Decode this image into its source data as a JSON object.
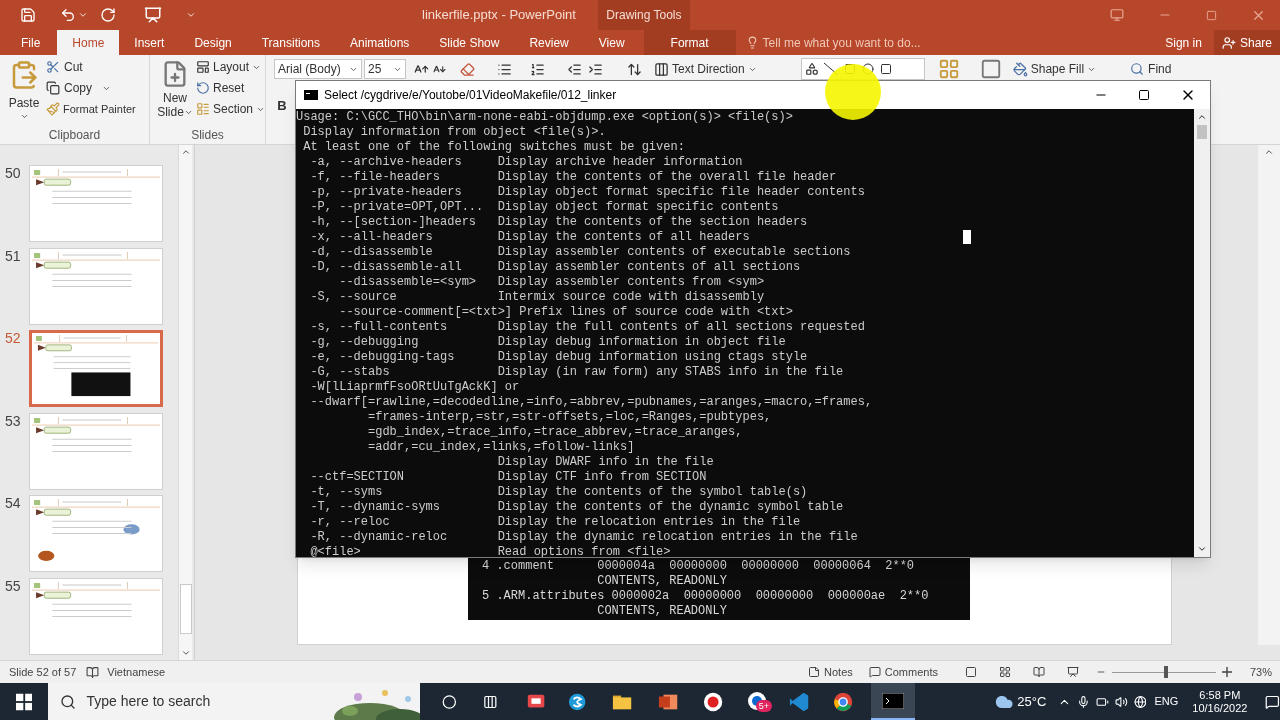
{
  "app": {
    "title": "linkerfile.pptx - PowerPoint",
    "contextual_group": "Drawing Tools"
  },
  "tabs": [
    {
      "label": "File",
      "selected": false,
      "kind": "file"
    },
    {
      "label": "Home",
      "selected": true,
      "kind": "standard"
    },
    {
      "label": "Insert",
      "selected": false,
      "kind": "standard"
    },
    {
      "label": "Design",
      "selected": false,
      "kind": "standard"
    },
    {
      "label": "Transitions",
      "selected": false,
      "kind": "standard"
    },
    {
      "label": "Animations",
      "selected": false,
      "kind": "standard"
    },
    {
      "label": "Slide Show",
      "selected": false,
      "kind": "standard"
    },
    {
      "label": "Review",
      "selected": false,
      "kind": "standard"
    },
    {
      "label": "View",
      "selected": false,
      "kind": "standard"
    },
    {
      "label": "Format",
      "selected": false,
      "kind": "contextual"
    }
  ],
  "tell_me": {
    "placeholder": "Tell me what you want to do..."
  },
  "account": {
    "sign_in": "Sign in",
    "share": "Share"
  },
  "ribbon": {
    "clipboard": {
      "paste": "Paste",
      "cut": "Cut",
      "copy": "Copy",
      "format_painter": "Format Painter",
      "label": "Clipboard"
    },
    "slides": {
      "new": "New",
      "slide": "Slide",
      "layout": "Layout",
      "reset": "Reset",
      "section": "Section",
      "label": "Slides"
    },
    "font": {
      "face": "Arial (Body)",
      "size": "25",
      "bold": "B"
    },
    "paragraph": {
      "text_direction": "Text Direction"
    },
    "drawing": {
      "shape_fill": "Shape Fill"
    },
    "editing": {
      "find": "Find"
    }
  },
  "thumbnails": [
    {
      "number": "50",
      "selected": false
    },
    {
      "number": "51",
      "selected": false
    },
    {
      "number": "52",
      "selected": true
    },
    {
      "number": "53",
      "selected": false
    },
    {
      "number": "54",
      "selected": false
    },
    {
      "number": "55",
      "selected": false
    }
  ],
  "slide": {
    "code_lines": [
      "4 .comment      0000004a  00000000  00000000  00000064  2**0",
      "                CONTENTS, READONLY",
      "5 .ARM.attributes 0000002a  00000000  00000000  000000ae  2**0",
      "                CONTENTS, READONLY"
    ]
  },
  "console": {
    "title": "Select /cygdrive/e/Youtobe/01VideoMakefile/012_linker",
    "lines": [
      "Usage: C:\\GCC_THO\\bin\\arm-none-eabi-objdump.exe <option(s)> <file(s)>",
      " Display information from object <file(s)>.",
      " At least one of the following switches must be given:",
      "  -a, --archive-headers     Display archive header information",
      "  -f, --file-headers        Display the contents of the overall file header",
      "  -p, --private-headers     Display object format specific file header contents",
      "  -P, --private=OPT,OPT...  Display object format specific contents",
      "  -h, --[section-]headers   Display the contents of the section headers",
      "  -x, --all-headers         Display the contents of all headers",
      "  -d, --disassemble         Display assembler contents of executable sections",
      "  -D, --disassemble-all     Display assembler contents of all sections",
      "      --disassemble=<sym>   Display assembler contents from <sym>",
      "  -S, --source              Intermix source code with disassembly",
      "      --source-comment[=<txt>] Prefix lines of source code with <txt>",
      "  -s, --full-contents       Display the full contents of all sections requested",
      "  -g, --debugging           Display debug information in object file",
      "  -e, --debugging-tags      Display debug information using ctags style",
      "  -G, --stabs               Display (in raw form) any STABS info in the file",
      "  -W[lLiaprmfFsoORtUuTgAckK] or",
      "  --dwarf[=rawline,=decodedline,=info,=abbrev,=pubnames,=aranges,=macro,=frames,",
      "          =frames-interp,=str,=str-offsets,=loc,=Ranges,=pubtypes,",
      "          =gdb_index,=trace_info,=trace_abbrev,=trace_aranges,",
      "          =addr,=cu_index,=links,=follow-links]",
      "                            Display DWARF info in the file",
      "  --ctf=SECTION             Display CTF info from SECTION",
      "  -t, --syms                Display the contents of the symbol table(s)",
      "  -T, --dynamic-syms        Display the contents of the dynamic symbol table",
      "  -r, --reloc               Display the relocation entries in the file",
      "  -R, --dynamic-reloc       Display the dynamic relocation entries in the file",
      "  @<file>                   Read options from <file>"
    ]
  },
  "status_bar": {
    "slide_info": "Slide 52 of 57",
    "language": "Vietnamese",
    "notes": "Notes",
    "comments": "Comments",
    "zoom": {
      "level": 0.5
    },
    "zoom_label": "73%"
  },
  "taskbar": {
    "search_placeholder": "Type here to search",
    "badge": "5+",
    "temperature": "25°C",
    "language": "ENG",
    "time": "6:58 PM",
    "date": "10/16/2022"
  }
}
